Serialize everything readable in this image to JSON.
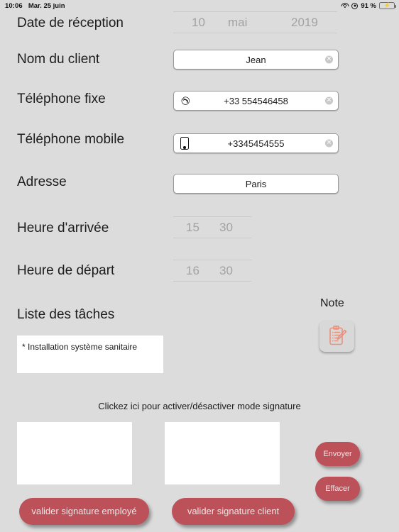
{
  "status_bar": {
    "time": "10:06",
    "date": "Mar. 25 juin",
    "battery_percent": "91 %",
    "wifi_icon": "wifi-icon",
    "location_icon": "location-services-icon",
    "battery_icon": "battery-charging-icon"
  },
  "form": {
    "date_reception": {
      "label": "Date de réception",
      "day": "10",
      "month": "mai",
      "year": "2019"
    },
    "client_name": {
      "label": "Nom du client",
      "value": "Jean",
      "clear_glyph": "✕"
    },
    "phone_fixed": {
      "label": "Téléphone fixe",
      "value": "+33 554546458",
      "icon": "phone-handset-icon",
      "clear_glyph": "✕"
    },
    "phone_mobile": {
      "label": "Téléphone mobile",
      "value": "+3345454555",
      "icon": "mobile-phone-icon",
      "clear_glyph": "✕"
    },
    "address": {
      "label": "Adresse",
      "value": "Paris"
    },
    "arrival_time": {
      "label": "Heure d'arrivée",
      "hour": "15",
      "minute": "30"
    },
    "departure_time": {
      "label": "Heure de départ",
      "hour": "16",
      "minute": "30"
    },
    "tasks": {
      "label": "Liste des tâches",
      "value": "* Installation système sanitaire"
    },
    "note": {
      "label": "Note",
      "icon": "clipboard-pencil-icon"
    }
  },
  "signature": {
    "hint": "Clickez ici pour activer/désactiver mode signature",
    "validate_employee": "valider signature employé",
    "validate_client": "valider signature client",
    "send": "Envoyer",
    "clear": "Effacer"
  },
  "colors": {
    "background": "#dcdcdc",
    "button_red": "#bc5159",
    "note_icon": "#e8917c",
    "battery_green": "#4cd55e"
  }
}
